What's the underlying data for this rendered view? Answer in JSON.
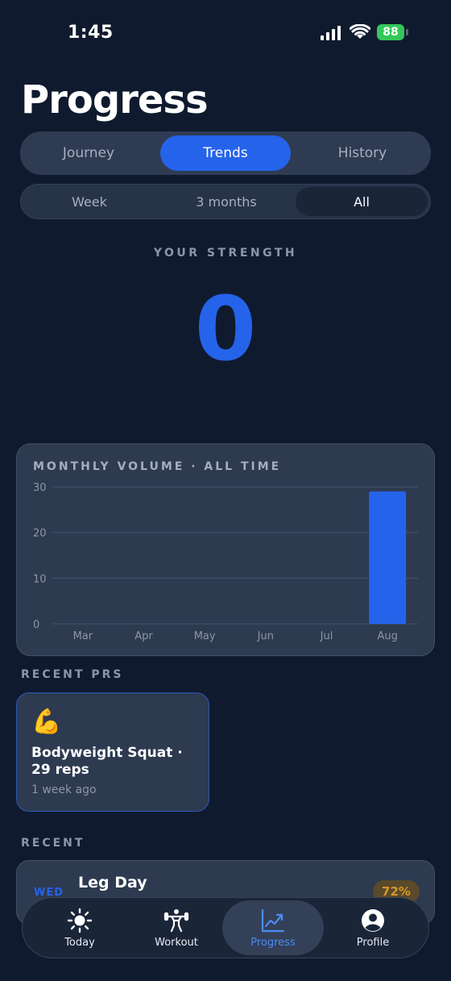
{
  "status_bar": {
    "time": "1:45",
    "battery": "88"
  },
  "header": {
    "title": "Progress"
  },
  "main_tabs": [
    {
      "label": "Journey",
      "active": false
    },
    {
      "label": "Trends",
      "active": true
    },
    {
      "label": "History",
      "active": false
    }
  ],
  "range_tabs": [
    {
      "label": "Week",
      "active": false
    },
    {
      "label": "3 months",
      "active": false
    },
    {
      "label": "All",
      "active": true
    }
  ],
  "strength": {
    "label": "YOUR STRENGTH",
    "value": "0"
  },
  "chart_data": {
    "type": "bar",
    "title": "MONTHLY VOLUME · ALL TIME",
    "categories": [
      "Mar",
      "Apr",
      "May",
      "Jun",
      "Jul",
      "Aug"
    ],
    "values": [
      0,
      0,
      0,
      0,
      0,
      29
    ],
    "ylim": [
      0,
      30
    ],
    "yticks": [
      0,
      10,
      20,
      30
    ],
    "grid": true,
    "bar_color": "#2563eb"
  },
  "recent_prs": {
    "label": "RECENT PRS",
    "items": [
      {
        "emoji": "💪",
        "title": "Bodyweight Squat · 29 reps",
        "time": "1 week ago"
      }
    ]
  },
  "recent": {
    "label": "RECENT",
    "items": [
      {
        "day": "WED",
        "title": "Leg Day",
        "badge": "72%"
      }
    ]
  },
  "tab_bar": [
    {
      "label": "Today",
      "icon": "sun-icon",
      "active": false
    },
    {
      "label": "Workout",
      "icon": "weightlifter-icon",
      "active": false
    },
    {
      "label": "Progress",
      "icon": "chart-trend-icon",
      "active": true
    },
    {
      "label": "Profile",
      "icon": "person-circle-icon",
      "active": false
    }
  ],
  "colors": {
    "accent": "#2563eb",
    "background": "#0f1a2e",
    "card": "#2d3a50",
    "battery": "#34c759",
    "badge_text": "#d4962c"
  }
}
